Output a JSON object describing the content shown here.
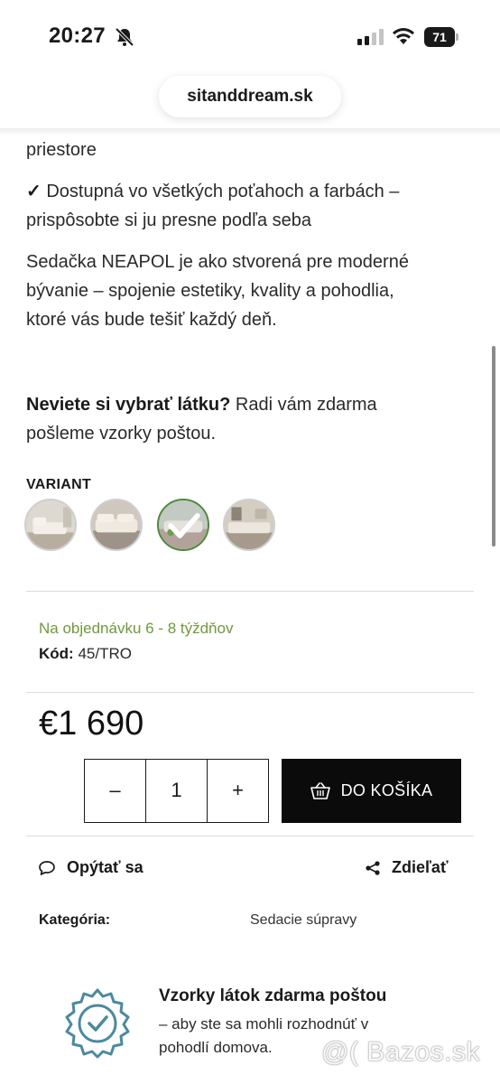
{
  "status_bar": {
    "time": "20:27",
    "battery": "71"
  },
  "browser": {
    "url": "sitanddream.sk"
  },
  "description": {
    "line_fragment": "priestore",
    "check_mark": "✓",
    "bullet_line1": " Dostupná vo všetkých poťahoch a farbách –",
    "bullet_line2": "prispôsobte si ju presne podľa seba",
    "para_line1": "Sedačka NEAPOL je ako stvorená pre moderné",
    "para_line2": "bývanie – spojenie estetiky, kvality a pohodlia,",
    "para_line3": "ktoré vás bude tešiť každý deň."
  },
  "fabric_help": {
    "bold": "Neviete si vybrať látku?",
    "rest": " Radi vám zdarma",
    "line2": "pošleme vzorky poštou."
  },
  "variant": {
    "label": "VARIANT",
    "selected_index": 2,
    "swatches": [
      "variant-1",
      "variant-2",
      "variant-3",
      "variant-4"
    ]
  },
  "availability": "Na objednávku 6 - 8 týždňov",
  "code": {
    "label": "Kód:",
    "value": " 45/TRO"
  },
  "price": "€1 690",
  "quantity": {
    "minus": "–",
    "value": "1",
    "plus": "+"
  },
  "cart_button": "DO KOŠÍKA",
  "actions": {
    "ask": "Opýtať sa",
    "share": "Zdieľať"
  },
  "category": {
    "label": "Kategória:",
    "value": "Sedacie súpravy"
  },
  "samples": {
    "title": "Vzorky látok zdarma poštou",
    "desc_line1": "– aby ste sa mohli rozhodnúť v",
    "desc_line2": "pohodlí domova."
  },
  "watermark": "@( Bazos.sk",
  "colors": {
    "availability": "#6e9a3c",
    "button": "#0b0b0b",
    "badge": "#4a8aa0"
  }
}
